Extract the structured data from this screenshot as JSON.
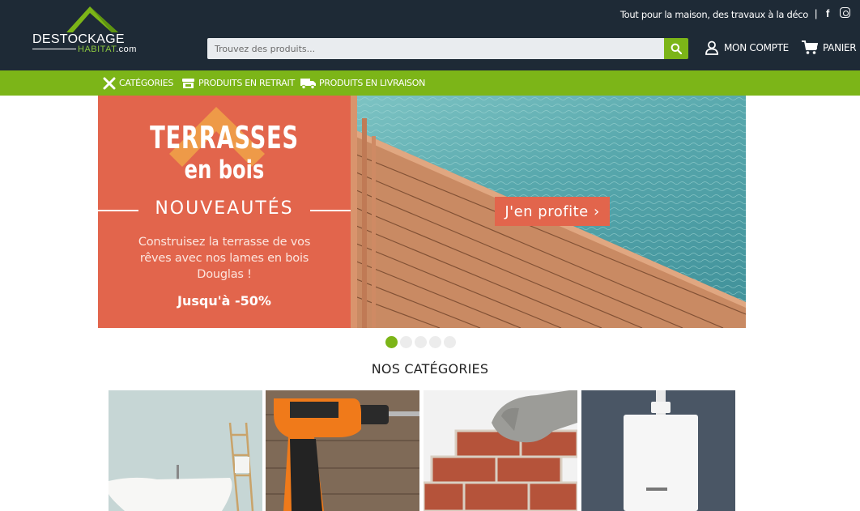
{
  "header": {
    "logo": {
      "name": "DESTOCKAGE",
      "sub": "HABITAT",
      "domain": ".com"
    },
    "tagline": "Tout pour la maison, des travaux à la déco",
    "separator": "|",
    "social": [
      {
        "icon": "facebook-icon",
        "label": "f"
      },
      {
        "icon": "instagram-icon"
      }
    ],
    "search": {
      "placeholder": "Trouvez des produits..."
    },
    "account_label": "MON COMPTE",
    "cart_label": "PANIER"
  },
  "nav": {
    "items": [
      {
        "label": "CATÉGORIES",
        "icon": "tools-icon"
      },
      {
        "label": "PRODUITS EN RETRAIT",
        "icon": "store-icon"
      },
      {
        "label": "PRODUITS EN LIVRAISON",
        "icon": "truck-icon"
      }
    ]
  },
  "hero": {
    "title_line1": "TERRASSES",
    "title_line2": "en bois",
    "badge": "NOUVEAUTÉS",
    "description": "Construisez la terrasse de vos rêves avec nos lames en bois Douglas !",
    "promo": "Jusqu'à -50%",
    "cta_label": "J'en profite ›",
    "dots": 5,
    "active_dot": 0
  },
  "categories": {
    "title": "NOS CATÉGORIES"
  },
  "colors": {
    "header_bg": "#1e2a36",
    "accent_green": "#7cb518",
    "hero_coral": "#e2654c"
  }
}
